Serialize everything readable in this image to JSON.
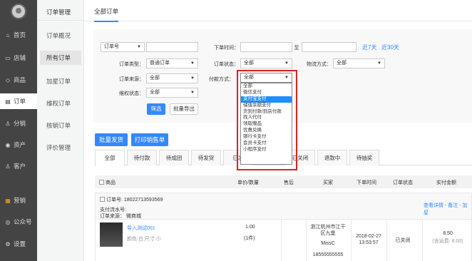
{
  "nav": {
    "items": [
      {
        "label": "首页",
        "icon": "home-icon",
        "glyph": "⌂"
      },
      {
        "label": "店铺",
        "icon": "store-icon",
        "glyph": "▭"
      },
      {
        "label": "商品",
        "icon": "tag-icon",
        "glyph": "◇"
      },
      {
        "label": "订单",
        "icon": "order-icon",
        "glyph": "▤"
      },
      {
        "label": "分销",
        "icon": "user-icon",
        "glyph": "♙"
      },
      {
        "label": "资产",
        "icon": "coin-icon",
        "glyph": "◉"
      },
      {
        "label": "客户",
        "icon": "customer-icon",
        "glyph": "♙"
      },
      {
        "label": "营销",
        "icon": "marketing-icon",
        "glyph": "▦"
      },
      {
        "label": "公众号",
        "icon": "wechat-icon",
        "glyph": "◎"
      },
      {
        "label": "设置",
        "icon": "settings-icon",
        "glyph": "⚙"
      }
    ]
  },
  "subnav": {
    "title": "订单管理",
    "items": [
      "订单概况",
      "所有订单",
      "加星订单",
      "维权订单",
      "核销订单",
      "评价管理"
    ]
  },
  "tabbar": {
    "tab": "全部订单"
  },
  "filter": {
    "order_no_select": "订单号",
    "order_time_label": "下单时间：",
    "to_label": "至",
    "last7": "近7天",
    "last30": "近30天",
    "order_type_label": "订单类型：",
    "order_type_value": "普通订单",
    "order_status_label": "订单状态：",
    "order_status_value": "全部",
    "logistics_label": "物流方式：",
    "logistics_value": "全部",
    "source_label": "订单来源：",
    "source_value": "全部",
    "payment_label": "付款方式：",
    "payment_value": "全部",
    "rights_label": "维权状态：",
    "rights_value": "全部",
    "filter_button": "筛选",
    "export_button": "批量导出"
  },
  "dropdown": {
    "options": [
      "全部",
      "微信支付",
      "支付宝支付",
      "储值余额支付",
      "货到付款/到店付款",
      "找人代付",
      "领取赠品",
      "优惠兑换",
      "银行卡支付",
      "会员卡支付",
      "小程序支付"
    ],
    "highlighted": "支付宝支付"
  },
  "actions": {
    "batch_ship": "批量发货",
    "print": "打印销售单"
  },
  "order_tabs": [
    "全部",
    "待付款",
    "待成团",
    "待发货",
    "已发",
    "已关闭",
    "退款中",
    "待抽奖"
  ],
  "table": {
    "headers": [
      "商品",
      "单价/数量",
      "售后",
      "买家",
      "下单时间",
      "订单状态",
      "实付金额"
    ]
  },
  "order": {
    "order_no": "订单号: 18022713593569",
    "pay_serial": "支付流水号:",
    "source": "订单来源： 微商城",
    "actions": "查看详情 - 备注 - 加星",
    "product_name": "导入测试001",
    "product_spec": "颜色:白,尺寸:小",
    "price": "1.00",
    "qty": "(1件)",
    "buyer_addr": "浙江杭州市江干区九堡",
    "buyer_name": "MissC",
    "buyer_phone": "18555555555",
    "date": "2018-02-27",
    "time": "13:53:57",
    "status": "已关闭",
    "amount": "8.50",
    "amount_note": "(含运费: 8.00)"
  },
  "colors": {
    "accent": "#3388ff",
    "nav_bg": "#444444",
    "highlight_red": "#e02020"
  }
}
